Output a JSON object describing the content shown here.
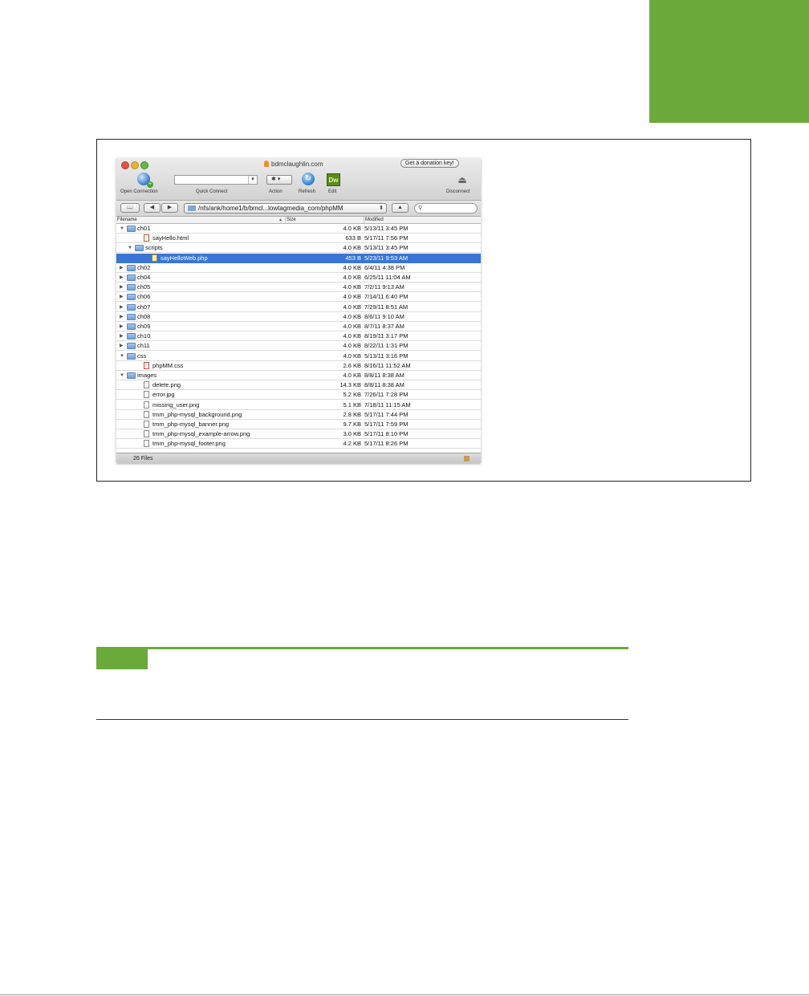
{
  "window": {
    "title": "bdmclaughlin.com",
    "donate_label": "Get a donation key!"
  },
  "toolbar": {
    "open_connection_label": "Open Connection",
    "quick_connect_label": "Quick Connect",
    "action_label": "Action",
    "refresh_label": "Refresh",
    "edit_label": "Edit",
    "edit_icon_text": "Dw",
    "disconnect_label": "Disconnect"
  },
  "pathbar": {
    "path": "/nfs/ank/home1/b/bmcl...lowtagmedia_com/phpMM",
    "search_placeholder": ""
  },
  "columns": {
    "filename": "Filename",
    "size": "Size",
    "modified": "Modified"
  },
  "files": [
    {
      "name": "ch01",
      "size": "4.0 KB",
      "modified": "5/13/11 3:45 PM",
      "kind": "folder",
      "depth": 0,
      "open": true
    },
    {
      "name": "sayHello.html",
      "size": "633 B",
      "modified": "5/17/11 7:56 PM",
      "kind": "html",
      "depth": 1
    },
    {
      "name": "scripts",
      "size": "4.0 KB",
      "modified": "5/13/11 3:45 PM",
      "kind": "folder",
      "depth": 1,
      "open": true
    },
    {
      "name": "sayHelloWeb.php",
      "size": "453 B",
      "modified": "5/23/11 9:53 AM",
      "kind": "php",
      "depth": 2,
      "selected": true
    },
    {
      "name": "ch02",
      "size": "4.0 KB",
      "modified": "6/4/11 4:38 PM",
      "kind": "folder",
      "depth": 0
    },
    {
      "name": "ch04",
      "size": "4.0 KB",
      "modified": "6/25/11 11:04 AM",
      "kind": "folder",
      "depth": 0
    },
    {
      "name": "ch05",
      "size": "4.0 KB",
      "modified": "7/2/11 9:13 AM",
      "kind": "folder",
      "depth": 0
    },
    {
      "name": "ch06",
      "size": "4.0 KB",
      "modified": "7/14/11 6:40 PM",
      "kind": "folder",
      "depth": 0
    },
    {
      "name": "ch07",
      "size": "4.0 KB",
      "modified": "7/29/11 8:51 AM",
      "kind": "folder",
      "depth": 0
    },
    {
      "name": "ch08",
      "size": "4.0 KB",
      "modified": "8/6/11 9:10 AM",
      "kind": "folder",
      "depth": 0
    },
    {
      "name": "ch09",
      "size": "4.0 KB",
      "modified": "8/7/11 8:37 AM",
      "kind": "folder",
      "depth": 0
    },
    {
      "name": "ch10",
      "size": "4.0 KB",
      "modified": "8/19/11 3:17 PM",
      "kind": "folder",
      "depth": 0
    },
    {
      "name": "ch11",
      "size": "4.0 KB",
      "modified": "8/22/11 1:31 PM",
      "kind": "folder",
      "depth": 0
    },
    {
      "name": "css",
      "size": "4.0 KB",
      "modified": "5/13/11 3:16 PM",
      "kind": "folder",
      "depth": 0,
      "open": true
    },
    {
      "name": "phpMM.css",
      "size": "2.6 KB",
      "modified": "8/16/11 11:52 AM",
      "kind": "css",
      "depth": 1
    },
    {
      "name": "images",
      "size": "4.0 KB",
      "modified": "8/8/11 8:38 AM",
      "kind": "folder",
      "depth": 0,
      "open": true
    },
    {
      "name": "delete.png",
      "size": "14.3 KB",
      "modified": "8/8/11 8:38 AM",
      "kind": "file",
      "depth": 1
    },
    {
      "name": "error.jpg",
      "size": "5.2 KB",
      "modified": "7/26/11 7:28 PM",
      "kind": "file",
      "depth": 1
    },
    {
      "name": "missing_user.png",
      "size": "5.1 KB",
      "modified": "7/18/11 11:15 AM",
      "kind": "file",
      "depth": 1
    },
    {
      "name": "tmm_php-mysql_background.png",
      "size": "2.8 KB",
      "modified": "5/17/11 7:44 PM",
      "kind": "file",
      "depth": 1
    },
    {
      "name": "tmm_php-mysql_banner.png",
      "size": "9.7 KB",
      "modified": "5/17/11 7:59 PM",
      "kind": "file",
      "depth": 1
    },
    {
      "name": "tmm_php-mysql_example-arrow.png",
      "size": "3.0 KB",
      "modified": "5/17/11 8:10 PM",
      "kind": "file",
      "depth": 1
    },
    {
      "name": "tmm_php-mysql_footer.png",
      "size": "4.2 KB",
      "modified": "5/17/11 8:26 PM",
      "kind": "file",
      "depth": 1
    }
  ],
  "status": {
    "file_count": "26 Files"
  },
  "colors": {
    "accent_green": "#6aaa3a",
    "selection_blue": "#3a75d6"
  }
}
